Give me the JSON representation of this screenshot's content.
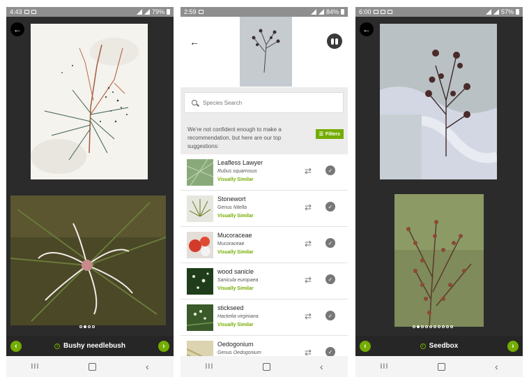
{
  "phone1": {
    "status": {
      "time": "4:43",
      "battery": "79%"
    },
    "pager": {
      "count": 4,
      "active": 1
    },
    "id_name": "Bushy needlebush",
    "prev_label": "‹",
    "next_label": "›",
    "back_label": "←"
  },
  "phone2": {
    "status": {
      "time": "2:59",
      "battery": "84%"
    },
    "back_label": "←",
    "search": {
      "placeholder": "Species Search"
    },
    "notice": "We're not confident enough to make a recommendation, but here are our top suggestions:",
    "filters_label": "Filters",
    "results": [
      {
        "name": "Leafless Lawyer",
        "prefix": "",
        "sci": "Rubus squarrosus",
        "sci_italic": true,
        "match": "Visually Similar"
      },
      {
        "name": "Stonewort",
        "prefix": "Genus ",
        "sci": "Nitella",
        "sci_italic": true,
        "match": "Visually Similar"
      },
      {
        "name": "Mucoraceae",
        "prefix": "",
        "sci": "Mucoraceae",
        "sci_italic": false,
        "match": "Visually Similar"
      },
      {
        "name": "wood sanicle",
        "prefix": "",
        "sci": "Sanicula europaea",
        "sci_italic": true,
        "match": "Visually Similar"
      },
      {
        "name": "stickseed",
        "prefix": "",
        "sci": "Hackelia virginiana",
        "sci_italic": true,
        "match": "Visually Similar"
      },
      {
        "name": "Oedogonium",
        "prefix": "Genus ",
        "sci": "Oedogonium",
        "sci_italic": true,
        "match": ""
      }
    ]
  },
  "phone3": {
    "status": {
      "time": "6:00",
      "battery": "57%"
    },
    "pager": {
      "count": 10,
      "active": 1
    },
    "id_name": "Seedbox",
    "prev_label": "‹",
    "next_label": "›",
    "back_label": "←"
  },
  "nav": {
    "recent": "III",
    "back": "‹"
  },
  "colors": {
    "accent": "#74ac00",
    "dark": "#2b2b2b"
  }
}
